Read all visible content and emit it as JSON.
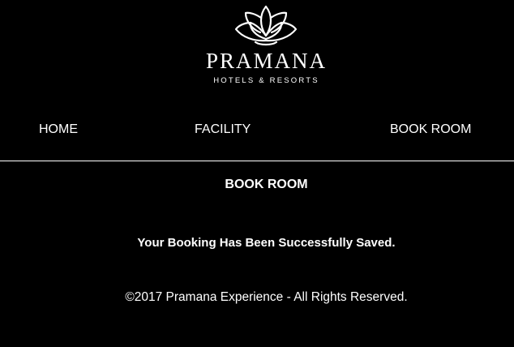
{
  "brand": {
    "name": "PRAMANA",
    "tagline": "HOTELS & RESORTS",
    "logo_icon": "lotus-icon"
  },
  "nav": {
    "home": "HOME",
    "facility": "FACILITY",
    "book_room": "BOOK ROOM"
  },
  "main": {
    "title": "BOOK ROOM",
    "message": "Your Booking Has Been Successfully Saved."
  },
  "footer": {
    "copyright": "©2017 Pramana Experience - All Rights Reserved."
  },
  "colors": {
    "background": "#000000",
    "text": "#ffffff"
  }
}
